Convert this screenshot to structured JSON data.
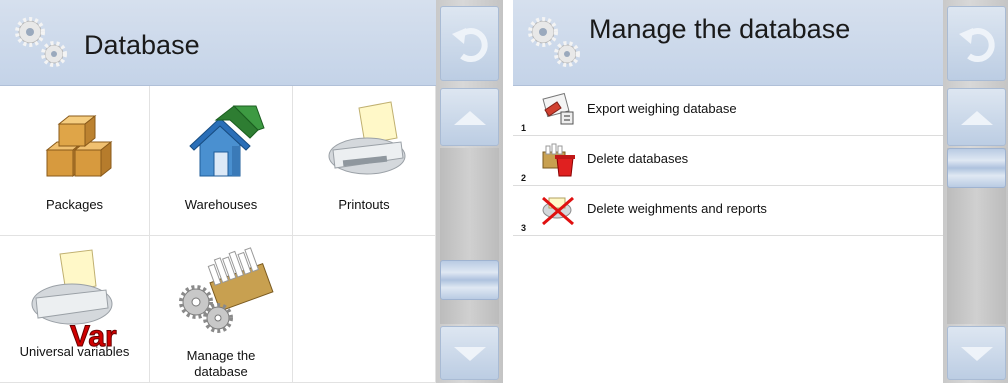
{
  "left": {
    "header": {
      "title": "Database"
    },
    "tiles": [
      {
        "label": "Packages"
      },
      {
        "label": "Warehouses"
      },
      {
        "label": "Printouts"
      },
      {
        "label": "Universal variables"
      },
      {
        "label": "Manage the database"
      }
    ],
    "var_badge": "Var"
  },
  "right": {
    "header": {
      "title": "Manage the database"
    },
    "items": [
      {
        "number": "1",
        "label": "Export weighing database",
        "icon": "export-database-icon"
      },
      {
        "number": "2",
        "label": "Delete databases",
        "icon": "delete-database-icon"
      },
      {
        "number": "3",
        "label": "Delete weighments and reports",
        "icon": "delete-weighments-icon"
      }
    ]
  },
  "colors": {
    "header": "#c9d6ea",
    "sidebar": "#cccccc",
    "sidebar_button": "#c8d6e9"
  }
}
